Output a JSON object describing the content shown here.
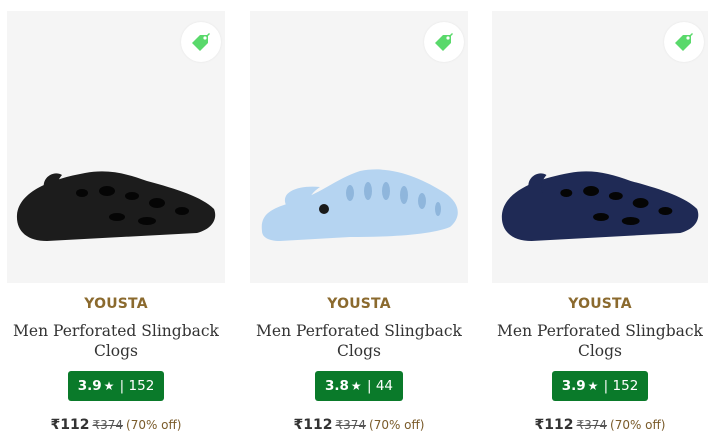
{
  "colors": {
    "brand_text": "#8b6a2e",
    "rating_badge": "#0a7a2a",
    "tag_icon": "#59d96b",
    "image_bg": "#f5f5f5"
  },
  "products": [
    {
      "brand": "YOUSTA",
      "name_line1": "Men Perforated Slingback",
      "name_line2": "Clogs",
      "rating": "3.9",
      "star": "★",
      "separator": "|",
      "rating_count": "152",
      "price": "₹112",
      "mrp": "₹374",
      "discount": "(70% off)",
      "shoe_color": "#1c1c1c",
      "icon": "price-tag-icon"
    },
    {
      "brand": "YOUSTA",
      "name_line1": "Men Perforated Slingback",
      "name_line2": "Clogs",
      "rating": "3.8",
      "star": "★",
      "separator": "|",
      "rating_count": "44",
      "price": "₹112",
      "mrp": "₹374",
      "discount": "(70% off)",
      "shoe_color": "#b5d4f1",
      "icon": "price-tag-icon"
    },
    {
      "brand": "YOUSTA",
      "name_line1": "Men Perforated Slingback",
      "name_line2": "Clogs",
      "rating": "3.9",
      "star": "★",
      "separator": "|",
      "rating_count": "152",
      "price": "₹112",
      "mrp": "₹374",
      "discount": "(70% off)",
      "shoe_color": "#1f2a55",
      "icon": "price-tag-icon"
    }
  ]
}
